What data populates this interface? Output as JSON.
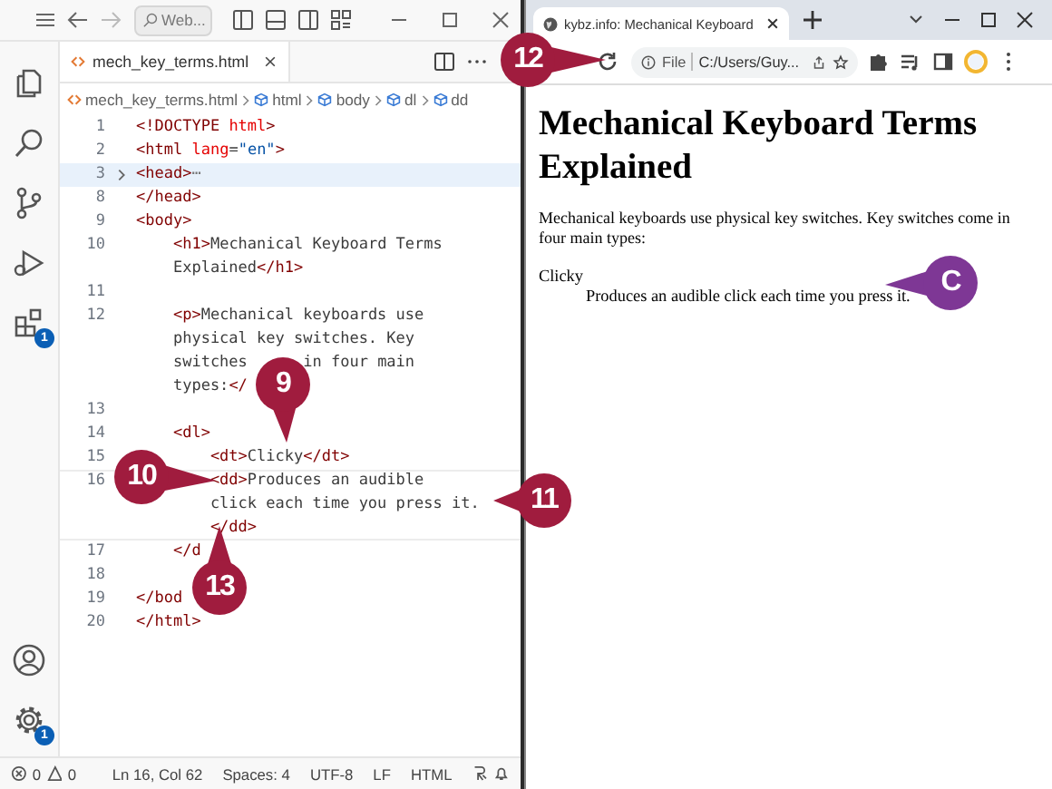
{
  "editor": {
    "search": "Web...",
    "tab": {
      "label": "mech_key_terms.html"
    },
    "breadcrumbs": [
      "mech_key_terms.html",
      "html",
      "body",
      "dl",
      "dd"
    ],
    "activity_bar": {
      "top": [
        {
          "kind": "files"
        },
        {
          "kind": "search"
        },
        {
          "kind": "source-control"
        },
        {
          "kind": "run"
        },
        {
          "kind": "extensions",
          "badge": "1"
        }
      ],
      "bottom": [
        {
          "kind": "account"
        },
        {
          "kind": "settings",
          "badge": "1"
        }
      ]
    },
    "lines": [
      {
        "number": "1",
        "folded": false,
        "highlighted": false,
        "current": false,
        "rows": [
          [
            {
              "kind": "tag",
              "text": "<!DOCTYPE "
            },
            {
              "kind": "attr",
              "text": "html"
            },
            {
              "kind": "tag",
              "text": ">"
            }
          ]
        ]
      },
      {
        "number": "2",
        "folded": false,
        "highlighted": false,
        "current": false,
        "rows": [
          [
            {
              "kind": "tag",
              "text": "<html "
            },
            {
              "kind": "attr",
              "text": "lang"
            },
            {
              "kind": "text",
              "text": "="
            },
            {
              "kind": "value",
              "text": "\"en\""
            },
            {
              "kind": "tag",
              "text": ">"
            }
          ]
        ]
      },
      {
        "number": "3",
        "folded": true,
        "highlighted": true,
        "current": false,
        "rows": [
          [
            {
              "kind": "tag",
              "text": "<head>"
            },
            {
              "kind": "fold",
              "text": "⋯"
            }
          ]
        ]
      },
      {
        "number": "8",
        "folded": false,
        "highlighted": false,
        "current": false,
        "rows": [
          [
            {
              "kind": "tag",
              "text": "</head>"
            }
          ]
        ]
      },
      {
        "number": "9",
        "folded": false,
        "highlighted": false,
        "current": false,
        "rows": [
          [
            {
              "kind": "tag",
              "text": "<body>"
            }
          ]
        ]
      },
      {
        "number": "10",
        "folded": false,
        "highlighted": false,
        "current": false,
        "rows": [
          [
            {
              "kind": "tag",
              "text": "    <h1>"
            },
            {
              "kind": "text",
              "text": "Mechanical Keyboard Terms"
            }
          ],
          [
            {
              "kind": "text",
              "text": "    Explained"
            },
            {
              "kind": "tag",
              "text": "</h1>"
            }
          ]
        ]
      },
      {
        "number": "11",
        "folded": false,
        "highlighted": false,
        "current": false,
        "rows": [
          []
        ]
      },
      {
        "number": "12",
        "folded": false,
        "highlighted": false,
        "current": false,
        "rows": [
          [
            {
              "kind": "tag",
              "text": "    <p>"
            },
            {
              "kind": "text",
              "text": "Mechanical keyboards use"
            }
          ],
          [
            {
              "kind": "text",
              "text": "    physical key switches. Key"
            }
          ],
          [
            {
              "kind": "text",
              "text": "    switches"
            },
            {
              "kind": "text",
              "text": "      in four main"
            }
          ],
          [
            {
              "kind": "text",
              "text": "    types:"
            },
            {
              "kind": "tag",
              "text": "</"
            }
          ]
        ]
      },
      {
        "number": "13",
        "folded": false,
        "highlighted": false,
        "current": false,
        "rows": [
          []
        ]
      },
      {
        "number": "14",
        "folded": false,
        "highlighted": false,
        "current": false,
        "rows": [
          [
            {
              "kind": "tag",
              "text": "    <dl>"
            }
          ]
        ]
      },
      {
        "number": "15",
        "folded": false,
        "highlighted": false,
        "current": false,
        "rows": [
          [
            {
              "kind": "tag",
              "text": "        <dt>"
            },
            {
              "kind": "text",
              "text": "Clicky"
            },
            {
              "kind": "tag",
              "text": "</dt>"
            }
          ]
        ]
      },
      {
        "number": "16",
        "folded": false,
        "highlighted": false,
        "current": true,
        "rows": [
          [
            {
              "kind": "tag",
              "text": "        <dd>"
            },
            {
              "kind": "text",
              "text": "Produces an audible"
            }
          ],
          [
            {
              "kind": "text",
              "text": "        click each time you press it."
            }
          ],
          [
            {
              "kind": "tag",
              "text": "        </dd>"
            }
          ]
        ]
      },
      {
        "number": "17",
        "folded": false,
        "highlighted": false,
        "current": false,
        "rows": [
          [
            {
              "kind": "tag",
              "text": "    </d"
            }
          ]
        ]
      },
      {
        "number": "18",
        "folded": false,
        "highlighted": false,
        "current": false,
        "rows": [
          []
        ]
      },
      {
        "number": "19",
        "folded": false,
        "highlighted": false,
        "current": false,
        "rows": [
          [
            {
              "kind": "tag",
              "text": "</bod"
            }
          ]
        ]
      },
      {
        "number": "20",
        "folded": false,
        "highlighted": false,
        "current": false,
        "rows": [
          [
            {
              "kind": "tag",
              "text": "</html>"
            }
          ]
        ]
      }
    ],
    "status_bar": {
      "errors": "0",
      "warnings": "0",
      "items": [
        "Ln 16, Col 62",
        "Spaces: 4",
        "UTF-8",
        "LF",
        "HTML"
      ]
    }
  },
  "browser": {
    "tab": {
      "title": "kybz.info: Mechanical Keyboard"
    },
    "address": {
      "scheme": "File",
      "path": "C:/Users/Guy..."
    },
    "page": {
      "heading": "Mechanical Keyboard Terms Explained",
      "paragraph": "Mechanical keyboards use physical key switches. Key switches come in four main types:",
      "terms": [
        {
          "term": "Clicky",
          "definition": "Produces an audible click each time you press it."
        }
      ]
    }
  },
  "callouts": [
    {
      "label": "12",
      "color": "#a01c3e"
    },
    {
      "label": "9",
      "color": "#a01c3e"
    },
    {
      "label": "10",
      "color": "#a01c3e"
    },
    {
      "label": "11",
      "color": "#a01c3e"
    },
    {
      "label": "13",
      "color": "#a01c3e"
    },
    {
      "label": "C",
      "color": "#7e3795"
    }
  ]
}
